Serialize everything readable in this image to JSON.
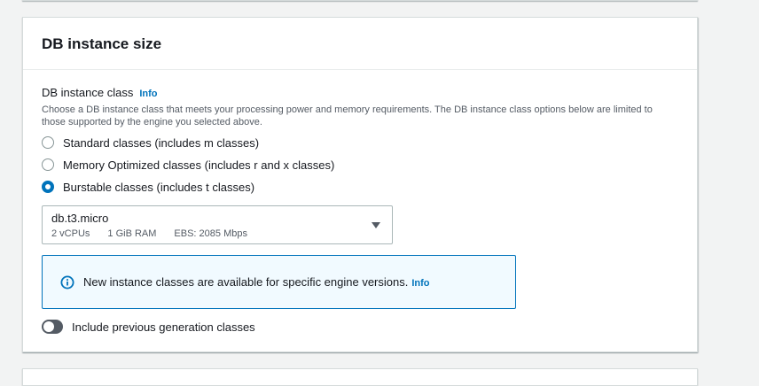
{
  "section": {
    "title": "DB instance size"
  },
  "instance_class": {
    "label": "DB instance class",
    "info_label": "Info",
    "description": "Choose a DB instance class that meets your processing power and memory requirements. The DB instance class options below are limited to those supported by the engine you selected above.",
    "options": [
      {
        "label": "Standard classes (includes m classes)",
        "selected": false
      },
      {
        "label": "Memory Optimized classes (includes r and x classes)",
        "selected": false
      },
      {
        "label": "Burstable classes (includes t classes)",
        "selected": true
      }
    ],
    "selected_class": {
      "name": "db.t3.micro",
      "vcpus": "2 vCPUs",
      "ram": "1 GiB RAM",
      "ebs": "EBS: 2085 Mbps"
    }
  },
  "alert": {
    "icon": "info-circle-icon",
    "text": "New instance classes are available for specific engine versions.",
    "info_label": "Info"
  },
  "toggle": {
    "label": "Include previous generation classes",
    "checked": false
  },
  "colors": {
    "accent": "#0073bb",
    "alert_background": "#f1faff",
    "toggle_off": "#545b64"
  }
}
